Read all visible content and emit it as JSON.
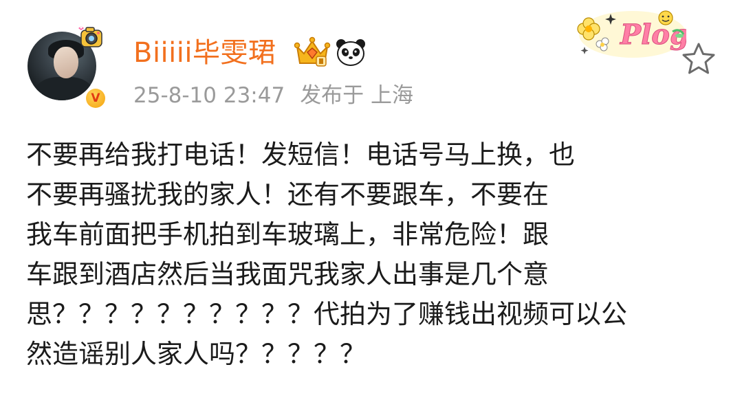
{
  "post": {
    "author": {
      "name": "Biiiii毕雯珺"
    },
    "meta": {
      "timestamp": "25-8-10 23:47",
      "location": "发布于 上海"
    },
    "verified_mark": "V",
    "decoration_text": "Plog",
    "content_lines": [
      "不要再给我打电话！发短信！电话号马上换，也",
      "不要再骚扰我的家人！还有不要跟车，不要在",
      "我车前面把手机拍到车玻璃上，非常危险！跟",
      "车跟到酒店然后当我面咒我家人出事是几个意",
      "思？？？？？？？？？？代拍为了赚钱出视频可以公",
      "然造谣别人家人吗？？？？？"
    ]
  },
  "icons": {
    "favorite": "star-outline-icon",
    "verified": "orange-v-badge-icon",
    "crown": "crown-badge-icon",
    "panda": "panda-badge-icon"
  },
  "colors": {
    "username": "#f2701e",
    "meta": "#9a9a9a",
    "text": "#1b1b1b",
    "verified": "#f5a20b"
  }
}
